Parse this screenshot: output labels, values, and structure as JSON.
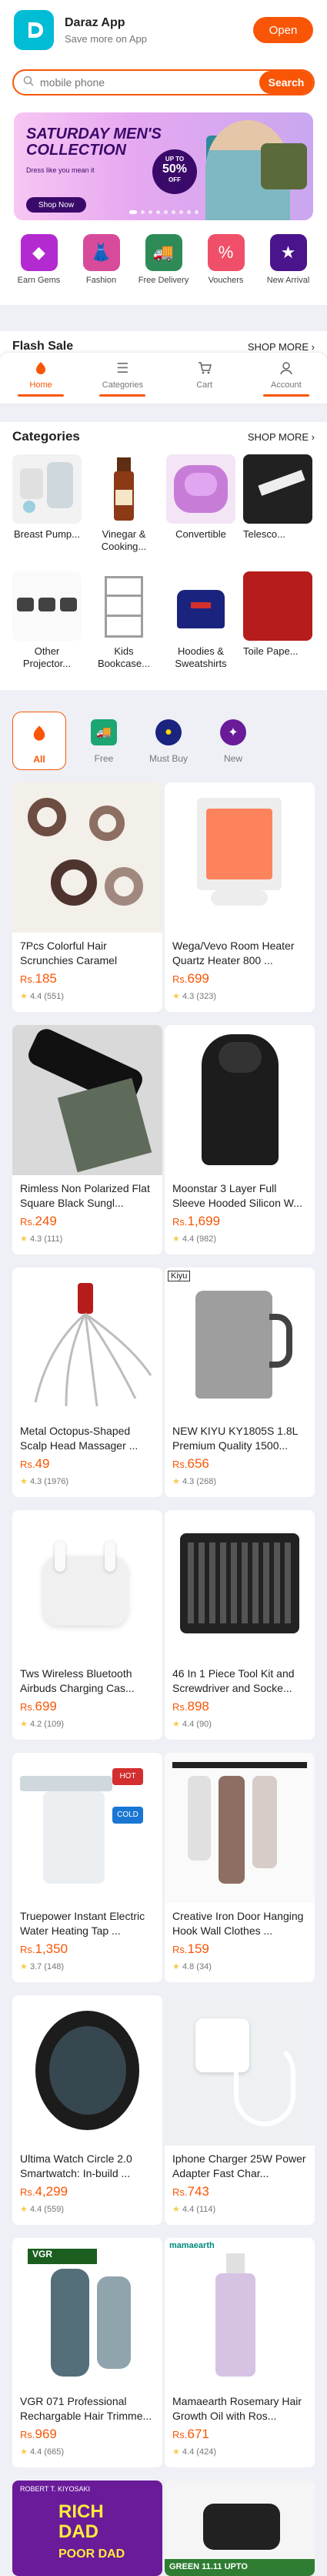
{
  "app_banner": {
    "name": "Daraz App",
    "subtitle": "Save more on App",
    "open_label": "Open"
  },
  "search": {
    "placeholder": "mobile phone",
    "button_label": "Search"
  },
  "hero": {
    "title_line1": "SATURDAY MEN'S",
    "title_line2": "COLLECTION",
    "tagline": "Dress like you mean it",
    "badge_top": "UP TO",
    "badge_value": "50%",
    "badge_bottom": "OFF",
    "shop_now": "Shop Now"
  },
  "quick_links": [
    {
      "label": "Earn Gems",
      "icon": "gem-icon",
      "color": "#9c27b0"
    },
    {
      "label": "Fashion",
      "icon": "fashion-icon",
      "color": "#e91e63"
    },
    {
      "label": "Free Delivery",
      "icon": "truck-icon",
      "color": "#2e7d32"
    },
    {
      "label": "Vouchers",
      "icon": "voucher-icon",
      "color": "#f44336"
    },
    {
      "label": "New Arrival",
      "icon": "new-arrival-icon",
      "color": "#4a148c"
    }
  ],
  "flash_sale": {
    "title": "Flash Sale",
    "shop_more": "SHOP MORE"
  },
  "tabbar": [
    {
      "label": "Home",
      "icon": "home-icon",
      "active": true
    },
    {
      "label": "Categories",
      "icon": "list-icon",
      "active": false
    },
    {
      "label": "Cart",
      "icon": "cart-icon",
      "active": false
    },
    {
      "label": "Account",
      "icon": "account-icon",
      "active": false
    }
  ],
  "categories": {
    "title": "Categories",
    "shop_more": "SHOP MORE",
    "items": [
      {
        "label": "Breast Pump..."
      },
      {
        "label": "Vinegar & Cooking..."
      },
      {
        "label": "Convertible"
      },
      {
        "label": "Telesco..."
      },
      {
        "label": "Other Projector..."
      },
      {
        "label": "Kids Bookcase..."
      },
      {
        "label": "Hoodies & Sweatshirts"
      },
      {
        "label": "Toile Pape..."
      }
    ]
  },
  "filters": [
    {
      "label": "All",
      "icon": "daraz-icon",
      "color": "#f85606",
      "active": true
    },
    {
      "label": "Free",
      "icon": "free-delivery-icon",
      "color": "#1ba672",
      "active": false
    },
    {
      "label": "Must Buy",
      "icon": "must-buy-icon",
      "color": "#1a237e",
      "active": false
    },
    {
      "label": "New",
      "icon": "new-icon",
      "color": "#6a1b9a",
      "active": false
    }
  ],
  "products": [
    {
      "title": "7Pcs Colorful Hair Scrunchies Caramel Colore...",
      "price": "185",
      "rating": "4.4",
      "reviews": "(551)"
    },
    {
      "title": "Wega/Vevo Room Heater Quartz Heater 800 ...",
      "price": "699",
      "rating": "4.3",
      "reviews": "(323)"
    },
    {
      "title": "Rimless Non Polarized Flat Square Black Sungl...",
      "price": "249",
      "rating": "4.3",
      "reviews": "(111)"
    },
    {
      "title": "Moonstar 3 Layer Full Sleeve Hooded Silicon W...",
      "price": "1,699",
      "rating": "4.4",
      "reviews": "(982)"
    },
    {
      "title": "Metal Octopus-Shaped Scalp Head Massager ...",
      "price": "49",
      "rating": "4.3",
      "reviews": "(1976)"
    },
    {
      "title": "NEW KIYU KY1805S 1.8L Premium Quality 1500...",
      "price": "656",
      "rating": "4.3",
      "reviews": "(268)"
    },
    {
      "title": "Tws Wireless Bluetooth Airbuds Charging Cas...",
      "price": "699",
      "rating": "4.2",
      "reviews": "(109)"
    },
    {
      "title": "46 In 1 Piece Tool Kit and Screwdriver and Socke...",
      "price": "898",
      "rating": "4.4",
      "reviews": "(90)"
    },
    {
      "title": "Truepower Instant Electric Water Heating Tap ...",
      "price": "1,350",
      "rating": "3.7",
      "reviews": "(148)"
    },
    {
      "title": "Creative Iron Door Hanging Hook Wall Clothes ...",
      "price": "159",
      "rating": "4.8",
      "reviews": "(34)"
    },
    {
      "title": "Ultima Watch Circle 2.0 Smartwatch: In-build ...",
      "price": "4,299",
      "rating": "4.4",
      "reviews": "(559)"
    },
    {
      "title": "Iphone Charger 25W Power Adapter Fast Char...",
      "price": "743",
      "rating": "4.4",
      "reviews": "(114)"
    },
    {
      "title": "VGR 071 Professional Rechargable Hair Trimme...",
      "price": "969",
      "rating": "4.4",
      "reviews": "(665)"
    },
    {
      "title": "Mamaearth Rosemary Hair Growth Oil with Ros...",
      "price": "671",
      "rating": "4.4",
      "reviews": "(424)"
    },
    {
      "title": "",
      "price": "",
      "rating": "",
      "reviews": ""
    },
    {
      "title": "",
      "price": "",
      "rating": "",
      "reviews": ""
    }
  ],
  "currency": "Rs.",
  "image_texts": {
    "kiyu": "Kiyu",
    "mamaearth": "mamaearth",
    "book_top": "ROBERT T. KIYOSAKI",
    "book_title_1": "RICH",
    "book_title_2": "DAD",
    "book_title_3": "POOR DAD",
    "promo": "GREEN 11.11",
    "promo_sub": "UPTO",
    "vgr": "VGR",
    "hot": "HOT",
    "cold": "COLD"
  }
}
